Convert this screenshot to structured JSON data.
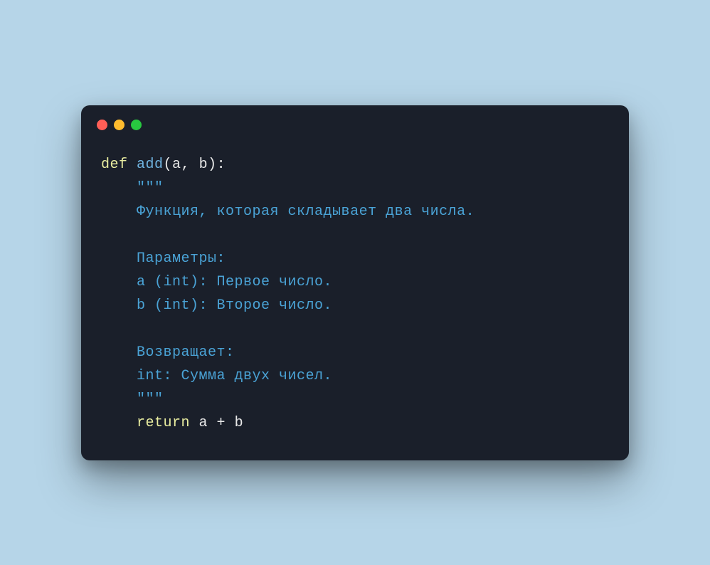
{
  "code": {
    "lines": [
      {
        "indent": 0,
        "tokens": [
          {
            "cls": "kw",
            "text": "def "
          },
          {
            "cls": "fn",
            "text": "add"
          },
          {
            "cls": "punct",
            "text": "("
          },
          {
            "cls": "param",
            "text": "a"
          },
          {
            "cls": "punct",
            "text": ", "
          },
          {
            "cls": "param",
            "text": "b"
          },
          {
            "cls": "punct",
            "text": "):"
          }
        ]
      },
      {
        "indent": 1,
        "tokens": [
          {
            "cls": "docstr",
            "text": "\"\"\""
          }
        ]
      },
      {
        "indent": 1,
        "tokens": [
          {
            "cls": "docstr",
            "text": "Функция, которая складывает два числа."
          }
        ]
      },
      {
        "indent": 0,
        "tokens": [
          {
            "cls": "docstr",
            "text": ""
          }
        ]
      },
      {
        "indent": 1,
        "tokens": [
          {
            "cls": "docstr",
            "text": "Параметры:"
          }
        ]
      },
      {
        "indent": 1,
        "tokens": [
          {
            "cls": "docstr",
            "text": "a (int): Первое число."
          }
        ]
      },
      {
        "indent": 1,
        "tokens": [
          {
            "cls": "docstr",
            "text": "b (int): Второе число."
          }
        ]
      },
      {
        "indent": 0,
        "tokens": [
          {
            "cls": "docstr",
            "text": ""
          }
        ]
      },
      {
        "indent": 1,
        "tokens": [
          {
            "cls": "docstr",
            "text": "Возвращает:"
          }
        ]
      },
      {
        "indent": 1,
        "tokens": [
          {
            "cls": "docstr",
            "text": "int: Сумма двух чисел."
          }
        ]
      },
      {
        "indent": 1,
        "tokens": [
          {
            "cls": "docstr",
            "text": "\"\"\""
          }
        ]
      },
      {
        "indent": 1,
        "tokens": [
          {
            "cls": "kw",
            "text": "return "
          },
          {
            "cls": "var",
            "text": "a "
          },
          {
            "cls": "op",
            "text": "+ "
          },
          {
            "cls": "var",
            "text": "b"
          }
        ]
      }
    ]
  },
  "colors": {
    "background_page": "#b6d5e8",
    "background_window": "#1a1f2a",
    "keyword": "#e9eda0",
    "function": "#6fb3e0",
    "docstring": "#4aa3d6",
    "default_text": "#e8e8e8",
    "traffic_red": "#ff5f57",
    "traffic_yellow": "#febc2e",
    "traffic_green": "#28c840"
  }
}
